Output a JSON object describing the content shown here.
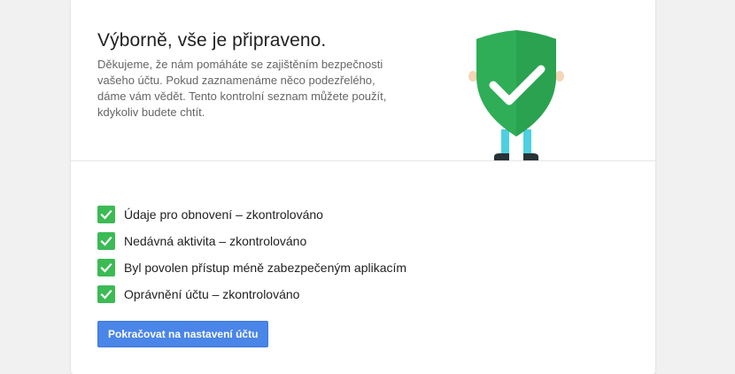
{
  "header": {
    "title": "Výborně, vše je připraveno.",
    "description": "Děkujeme, že nám pomáháte se zajištěním bezpečnosti vašeho účtu. Pokud zaznamenáme něco podezřelého, dáme vám vědět. Tento kontrolní seznam můžete použít, kdykoliv budete chtít."
  },
  "illustration": {
    "icon": "shield-check-icon",
    "shield_color": "#2fae57",
    "shield_shade_color": "#27994b"
  },
  "checklist": [
    {
      "label": "Údaje pro obnovení – zkontrolováno",
      "checked": true
    },
    {
      "label": "Nedávná aktivita – zkontrolováno",
      "checked": true
    },
    {
      "label": "Byl povolen přístup méně zabezpečeným aplikacím",
      "checked": true
    },
    {
      "label": "Oprávnění účtu – zkontrolováno",
      "checked": true
    }
  ],
  "actions": {
    "continue_label": "Pokračovat na nastavení účtu"
  },
  "colors": {
    "check_green": "#3cba54",
    "button_blue": "#4a85e8",
    "page_bg": "#f1f1f1"
  }
}
